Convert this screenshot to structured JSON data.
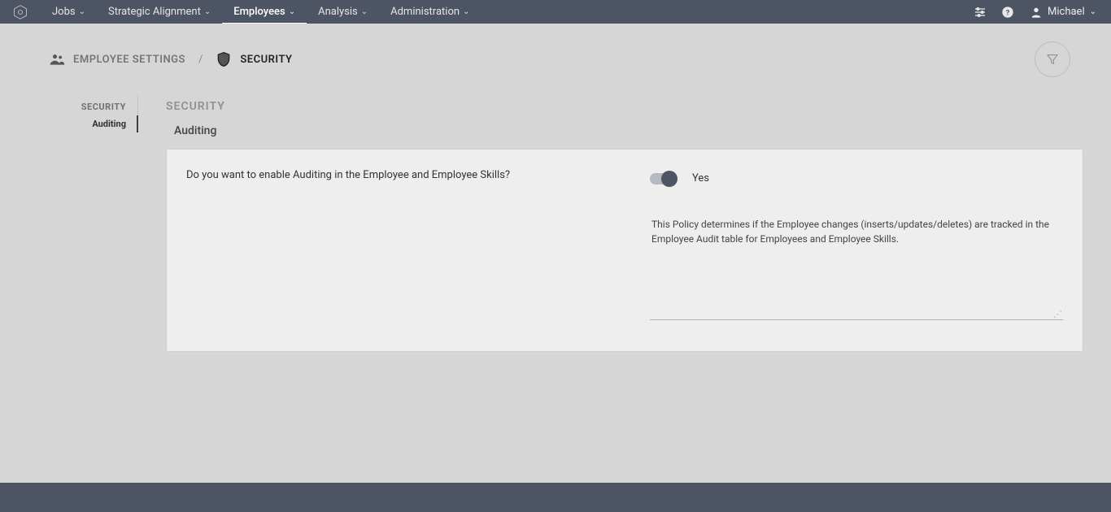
{
  "nav": {
    "items": [
      {
        "label": "Jobs"
      },
      {
        "label": "Strategic Alignment"
      },
      {
        "label": "Employees"
      },
      {
        "label": "Analysis"
      },
      {
        "label": "Administration"
      }
    ],
    "active_index": 2,
    "user": "Michael"
  },
  "breadcrumb": {
    "level1": "EMPLOYEE SETTINGS",
    "level2": "SECURITY"
  },
  "sidebar": {
    "section": "SECURITY",
    "items": [
      {
        "label": "Auditing"
      }
    ]
  },
  "main": {
    "section_title": "SECURITY",
    "subsection_title": "Auditing",
    "question": "Do you want to enable Auditing in the Employee and Employee Skills?",
    "toggle_value_label": "Yes",
    "description": "This Policy determines if the Employee changes (inserts/updates/deletes) are tracked in the Employee Audit table for Employees and Employee Skills."
  }
}
